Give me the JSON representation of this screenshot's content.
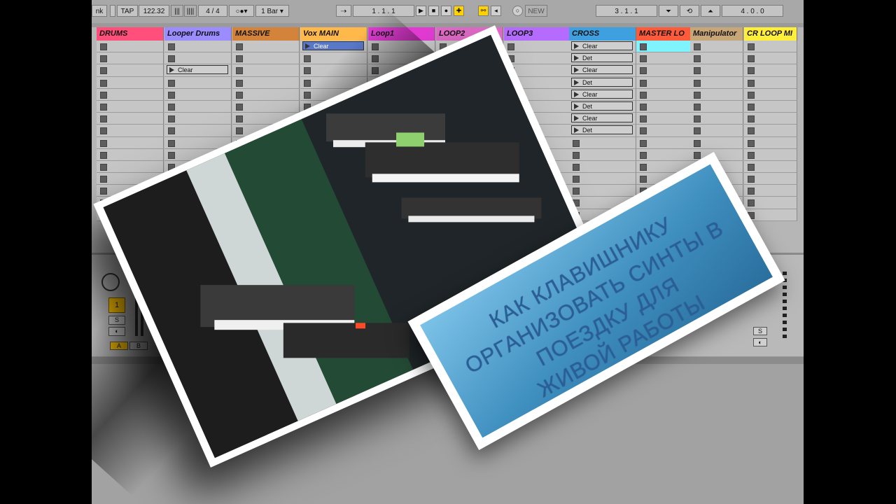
{
  "transport": {
    "link": "nk",
    "tap": "TAP",
    "tempo": "122.32",
    "signature_num": "4",
    "signature_sep": "/",
    "signature_den": "4",
    "metro": "1 Bar",
    "arrangement_position": "1 .   1 .   1",
    "new": "NEW",
    "loop_start": "3 .   1 .   1",
    "loop_length": "4 .   0 .   0"
  },
  "tracks": [
    {
      "name": "DRUMS",
      "color": "#ff4f7a"
    },
    {
      "name": "Looper Drums",
      "color": "#9b8cff"
    },
    {
      "name": "MASSIVE",
      "color": "#d4843a"
    },
    {
      "name": "Vox MAIN",
      "color": "#ffb84a"
    },
    {
      "name": "Loop1",
      "color": "#e23bd3"
    },
    {
      "name": "LOOP2",
      "color": "#e06bc7"
    },
    {
      "name": "LOOP3",
      "color": "#b66bff"
    },
    {
      "name": "CROSS",
      "color": "#3fa0e0"
    },
    {
      "name": "MASTER LO",
      "color": "#ff5a3a"
    },
    {
      "name": "Manipulator",
      "color": "#c7a678"
    },
    {
      "name": "CR LOOP MI",
      "color": "#ffef3a"
    }
  ],
  "clips": {
    "looper_clear": "Clear",
    "vox_clear": "Clear",
    "cross": [
      "Clear",
      "Det",
      "Clear",
      "Det",
      "Clear",
      "Det",
      "Clear",
      "Det"
    ]
  },
  "mixer": {
    "track_number": "1",
    "solo": "S",
    "crossfade_a": "A",
    "crossfade_b": "B"
  },
  "banner": {
    "line1": "КАК КЛАВИШНИКУ",
    "line2": "ОРГАНИЗОВАТЬ СИНТЫ В",
    "line3": "ПОЕЗДКУ ДЛЯ",
    "line4": "ЖИВОЙ РАБОТЫ"
  }
}
